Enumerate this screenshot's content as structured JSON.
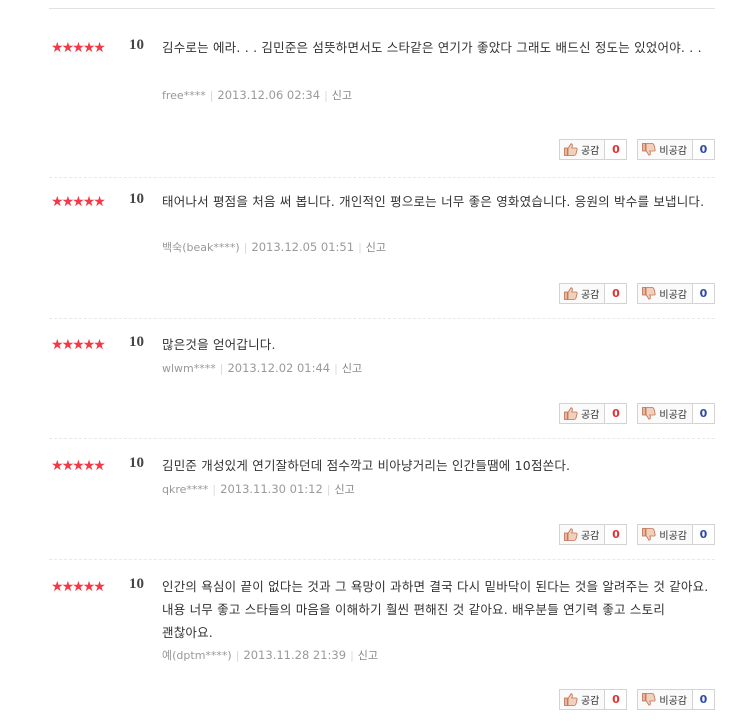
{
  "labels": {
    "sympathy": "공감",
    "antipathy": "비공감",
    "report": "신고",
    "star": "★"
  },
  "colors": {
    "star": "#f43845",
    "sympathy_count": "#e03030",
    "antipathy_count": "#2e4aa6"
  },
  "reviews": [
    {
      "rating": "10",
      "stars": 5,
      "comment": "김수로는 에라. . . 김민준은 섬뜻하면서도 스타같은 연기가 좋았다 그래도 배드신 정도는 있었어야. . .",
      "user": "free****",
      "date": "2013.12.06 02:34",
      "sympathy": "0",
      "antipathy": "0"
    },
    {
      "rating": "10",
      "stars": 5,
      "comment": "태어나서 평점을 처음 써 봅니다. 개인적인 평으로는 너무 좋은 영화였습니다. 응원의 박수를 보냅니다.",
      "user": "백숙(beak****)",
      "date": "2013.12.05 01:51",
      "sympathy": "0",
      "antipathy": "0"
    },
    {
      "rating": "10",
      "stars": 5,
      "comment": "많은것을 얻어갑니다.",
      "user": "wlwm****",
      "date": "2013.12.02 01:44",
      "sympathy": "0",
      "antipathy": "0"
    },
    {
      "rating": "10",
      "stars": 5,
      "comment": "김민준 개성있게 연기잘하던데 점수깍고 비아냥거리는 인간들땜에 10점쏜다.",
      "user": "qkre****",
      "date": "2013.11.30 01:12",
      "sympathy": "0",
      "antipathy": "0"
    },
    {
      "rating": "10",
      "stars": 5,
      "comment": "인간의 욕심이 끝이 없다는 것과 그 욕망이 과하면 결국 다시 밑바닥이 된다는 것을 알려주는 것 같아요. 내용 너무 좋고 스타들의 마음을 이해하기 훨씬 편해진 것 같아요. 배우분들 연기력 좋고 스토리 괜찮아요.",
      "user": "예(dptm****)",
      "date": "2013.11.28 21:39",
      "sympathy": "0",
      "antipathy": "0"
    }
  ]
}
